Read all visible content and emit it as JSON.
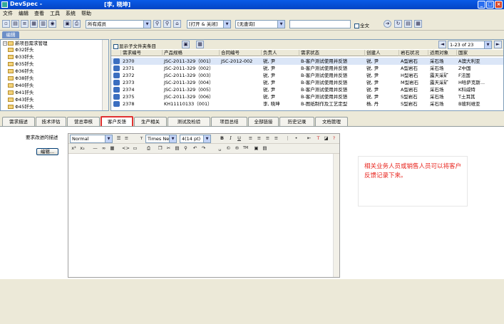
{
  "window": {
    "app_title": "DevSpec -",
    "user_title": "[李, 晓坤]"
  },
  "menu": [
    "文件",
    "编辑",
    "查看",
    "工具",
    "系统",
    "帮助"
  ],
  "toolbar": {
    "member_combo": "所有成员",
    "status_combo": "[打开 & 关闭]",
    "query_combo": "[无查询]",
    "search_value": "",
    "fulltext_label": "全文"
  },
  "edit_tab": "编辑",
  "tree": {
    "root": "新项目需求管理",
    "items": [
      "Φ32钎头",
      "Φ33钎头",
      "Φ35钎头",
      "Φ36钎头",
      "Φ38钎头",
      "Φ40钎头",
      "Φ41钎头",
      "Φ43钎头",
      "Φ45钎头"
    ]
  },
  "grid": {
    "show_sub_label": "显示子文件夹条目",
    "pager": "1-23 of 23",
    "columns": [
      "需求编号",
      "产品规格",
      "合同编号",
      "负责人",
      "需求状态",
      "创建人",
      "岩石状况",
      "适用对象",
      "国家"
    ],
    "rows": [
      [
        "2370",
        "JSC-2011-329（001）",
        "JSC-2012-002",
        "锐, 尹",
        "B-客户测试使用并反馈",
        "锐, 尹",
        "A型岩石",
        "采石场",
        "A澳大利亚"
      ],
      [
        "2371",
        "JSC-2011-329（002）",
        "",
        "锐, 尹",
        "B-客户测试使用并反馈",
        "锐, 尹",
        "A型岩石",
        "采石场",
        "Z中国"
      ],
      [
        "2372",
        "JSC-2011-329（003）",
        "",
        "锐, 尹",
        "B-客户测试使用并反馈",
        "锐, 尹",
        "H型岩石",
        "露天采矿",
        "F法国"
      ],
      [
        "2373",
        "JSC-2011-329（004）",
        "",
        "锐, 尹",
        "B-客户测试使用并反馈",
        "锐, 尹",
        "M型岩石",
        "露天采矿",
        "H哈萨克斯..."
      ],
      [
        "2374",
        "JSC-2011-329（005）",
        "",
        "锐, 尹",
        "B-客户测试使用并反馈",
        "锐, 尹",
        "A型岩石",
        "采石场",
        "K科威特"
      ],
      [
        "2375",
        "JSC-2011-329（006）",
        "",
        "锐, 尹",
        "B-客户测试使用并反馈",
        "锐, 尹",
        "S型岩石",
        "采石场",
        "T土耳其"
      ],
      [
        "2378",
        "KH11110133（001）",
        "",
        "李, 晓坤",
        "B-图纸制作及工艺定型",
        "杨, 丹",
        "S型岩石",
        "采石场",
        "B玻利维亚"
      ]
    ]
  },
  "tabs": [
    "需求描述",
    "技术评估",
    "营总审核",
    "客户反馈",
    "生产相关",
    "测试及检验",
    "项目总结",
    "全部链接",
    "历史记录",
    "文档管理"
  ],
  "active_tab": "客户反馈",
  "content": {
    "req_label": "要求改进的描述",
    "edit_button": "编辑...",
    "editor_style": "Normal",
    "editor_font": "Times Ne",
    "editor_size": "4(14 pt)",
    "note": "相关业务人员或销售人员可以将客户反馈记录下来。"
  }
}
